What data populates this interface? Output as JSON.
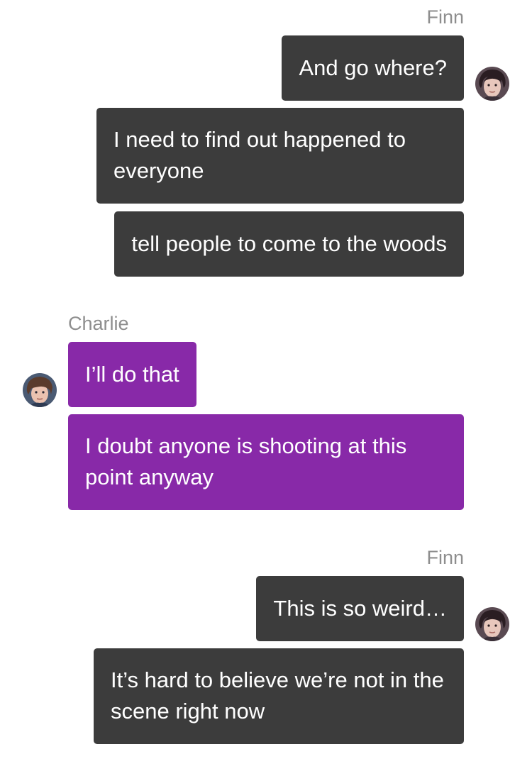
{
  "blocks": [
    {
      "sender": "Finn",
      "messages": [
        "And go where?",
        "I need to find out happened to everyone",
        "tell people to come to the woods"
      ]
    },
    {
      "sender": "Charlie",
      "messages": [
        "I’ll do that",
        "I doubt anyone is shooting at this point anyway"
      ]
    },
    {
      "sender": "Finn",
      "messages": [
        "This is so weird…",
        "It’s hard to believe we’re not in the scene right now"
      ]
    }
  ],
  "colors": {
    "outgoing_bubble": "#3c3c3c",
    "incoming_bubble": "#8829a8",
    "sender_name": "#8e8e8e",
    "bubble_text": "#ffffff"
  },
  "icons": {
    "finn_avatar": "avatar-finn-icon",
    "charlie_avatar": "avatar-charlie-icon"
  }
}
